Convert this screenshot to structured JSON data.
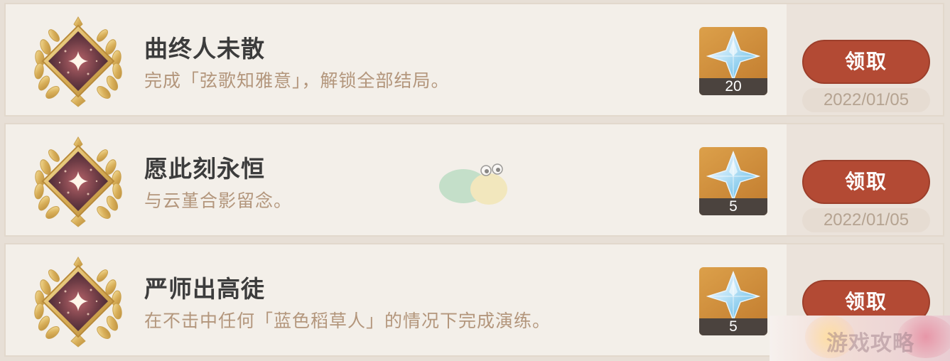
{
  "achievements": [
    {
      "title": "曲终人未散",
      "description": "完成「弦歌知雅意」，解锁全部结局。",
      "reward_count": "20",
      "claim_label": "领取",
      "date": "2022/01/05"
    },
    {
      "title": "愿此刻永恒",
      "description": "与云堇合影留念。",
      "reward_count": "5",
      "claim_label": "领取",
      "date": "2022/01/05"
    },
    {
      "title": "严师出高徒",
      "description": "在不击中任何「蓝色稻草人」的情况下完成演练。",
      "reward_count": "5",
      "claim_label": "领取"
    }
  ],
  "watermark": {
    "text": "游戏攻略"
  },
  "icons": {
    "badge": "gold-laurel-achievement-badge-icon",
    "reward": "primogem-icon",
    "mascot": "snail-mascot-icon"
  },
  "colors": {
    "claim_button": "#b34a34",
    "card_background": "#f3efe9",
    "title_text": "#3c3c3c",
    "description_text": "#b3967c",
    "reward_background": "#dca04a"
  }
}
